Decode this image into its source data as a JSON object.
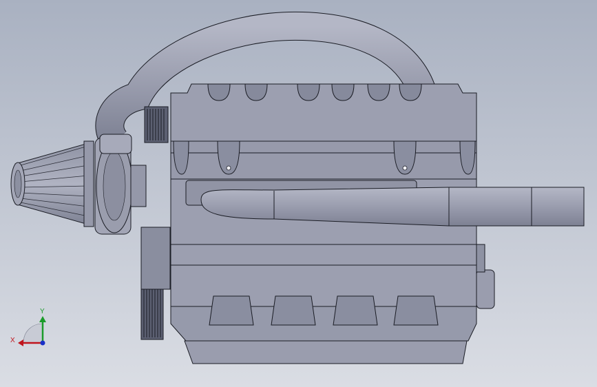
{
  "viewport": {
    "background_top": "#a9b1c1",
    "background_bottom": "#dadde4",
    "model_fill": "#9c9fb0",
    "model_shade": "#868a9c",
    "model_dark": "#6f7385",
    "edge_color": "#1a1c24"
  },
  "triad": {
    "x_label": "X",
    "y_label": "Y",
    "x_color": "#c0141c",
    "y_color": "#1b9b2a",
    "z_color": "#1830c8"
  },
  "parts": {
    "icons": [
      "air-filter-icon",
      "turbocharger-icon",
      "intake-pipe-icon",
      "exhaust-pipe-icon",
      "engine-block-icon",
      "timing-pulley-icon"
    ]
  }
}
